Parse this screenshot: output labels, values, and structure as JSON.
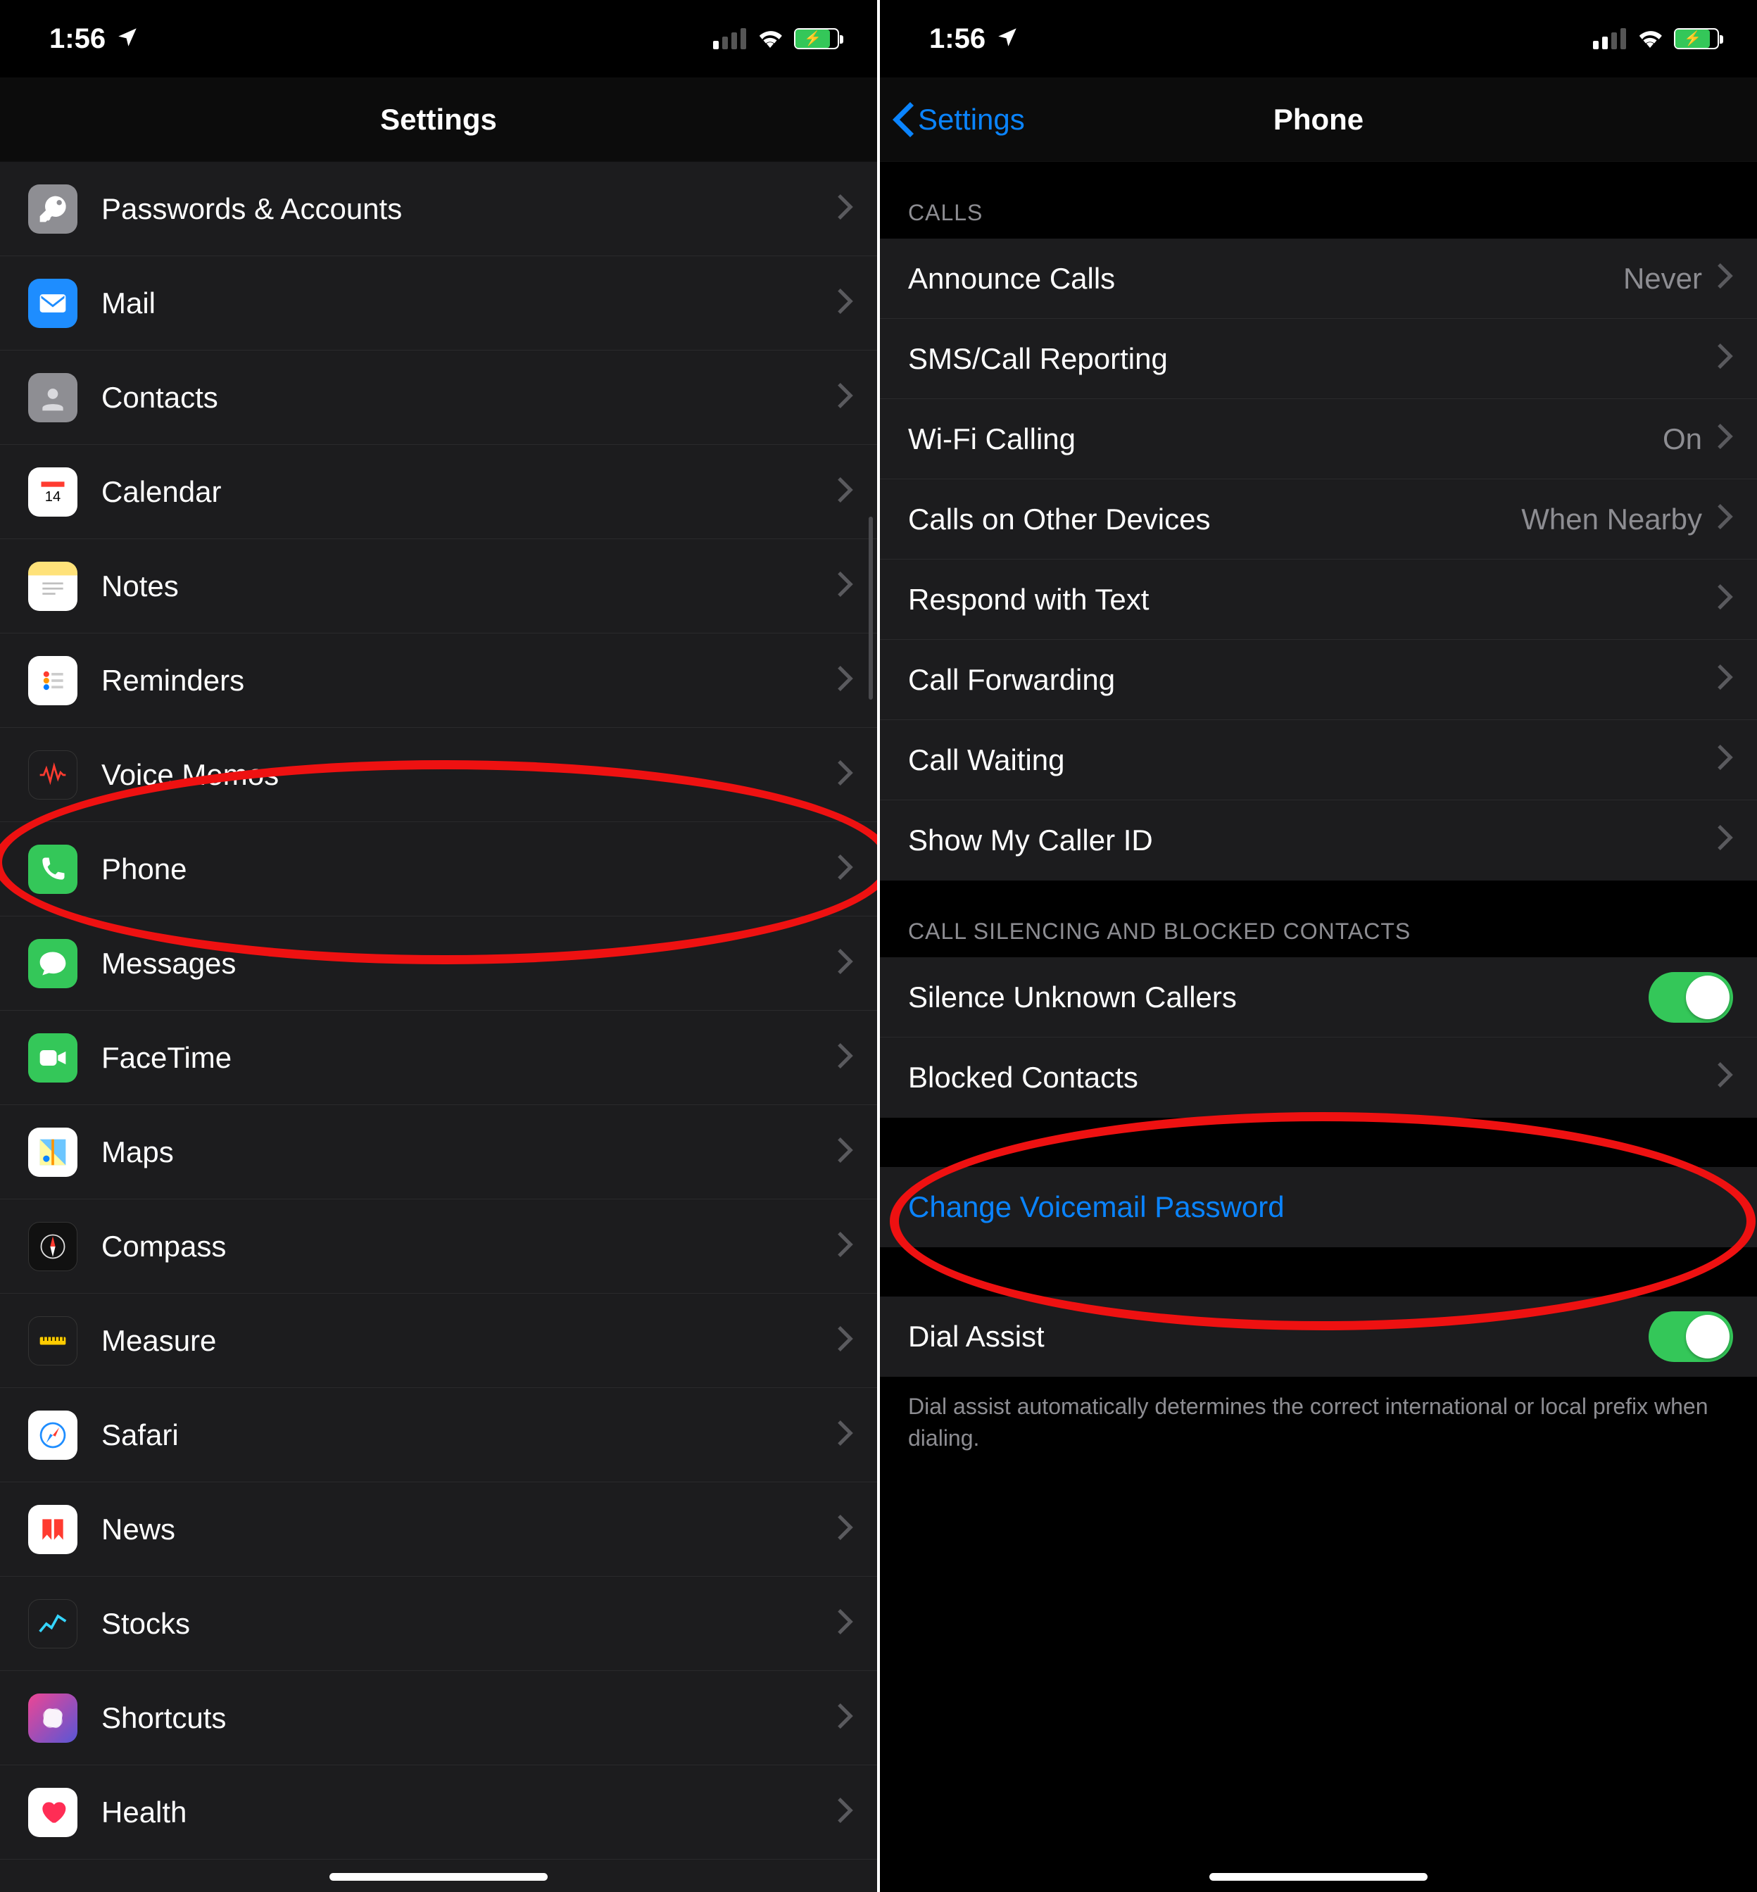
{
  "status": {
    "time": "1:56"
  },
  "left": {
    "title": "Settings",
    "items": [
      {
        "icon": "passwords",
        "label": "Passwords & Accounts"
      },
      {
        "icon": "mail",
        "label": "Mail"
      },
      {
        "icon": "contacts",
        "label": "Contacts"
      },
      {
        "icon": "calendar",
        "label": "Calendar"
      },
      {
        "icon": "notes",
        "label": "Notes"
      },
      {
        "icon": "reminders",
        "label": "Reminders"
      },
      {
        "icon": "voicememos",
        "label": "Voice Memos"
      },
      {
        "icon": "phone",
        "label": "Phone"
      },
      {
        "icon": "messages",
        "label": "Messages"
      },
      {
        "icon": "facetime",
        "label": "FaceTime"
      },
      {
        "icon": "maps",
        "label": "Maps"
      },
      {
        "icon": "compass",
        "label": "Compass"
      },
      {
        "icon": "measure",
        "label": "Measure"
      },
      {
        "icon": "safari",
        "label": "Safari"
      },
      {
        "icon": "news",
        "label": "News"
      },
      {
        "icon": "stocks",
        "label": "Stocks"
      },
      {
        "icon": "shortcuts",
        "label": "Shortcuts"
      },
      {
        "icon": "health",
        "label": "Health"
      }
    ]
  },
  "right": {
    "back": "Settings",
    "title": "Phone",
    "sections": {
      "calls": {
        "header": "CALLS",
        "rows": [
          {
            "label": "Announce Calls",
            "value": "Never"
          },
          {
            "label": "SMS/Call Reporting"
          },
          {
            "label": "Wi-Fi Calling",
            "value": "On"
          },
          {
            "label": "Calls on Other Devices",
            "value": "When Nearby"
          },
          {
            "label": "Respond with Text"
          },
          {
            "label": "Call Forwarding"
          },
          {
            "label": "Call Waiting"
          },
          {
            "label": "Show My Caller ID"
          }
        ]
      },
      "silencing": {
        "header": "CALL SILENCING AND BLOCKED CONTACTS",
        "rows": [
          {
            "label": "Silence Unknown Callers",
            "toggle": true
          },
          {
            "label": "Blocked Contacts"
          }
        ]
      },
      "voicemail": {
        "rows": [
          {
            "label": "Change Voicemail Password",
            "link": true
          }
        ]
      },
      "dial": {
        "rows": [
          {
            "label": "Dial Assist",
            "toggle": true
          }
        ],
        "footer": "Dial assist automatically determines the correct international or local prefix when dialing."
      }
    }
  }
}
